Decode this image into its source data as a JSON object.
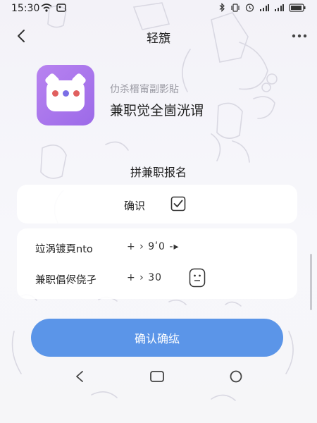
{
  "status_bar": {
    "time": "15:30",
    "left_icons": [
      "wifi-icon",
      "image-icon"
    ],
    "right_icons": [
      "bluetooth-icon",
      "vibrate-icon",
      "alarm-icon",
      "signal-icon",
      "signal-icon",
      "battery-icon"
    ]
  },
  "header": {
    "title": "轻籏",
    "back_icon": "chevron-left-icon",
    "more_icon": "more-dots-icon"
  },
  "app": {
    "subtitle": "仂杀榗甯副影貼",
    "name": "兼职觉全崮洸谓",
    "colors": {
      "icon_gradient_start": "#b883f0",
      "icon_gradient_end": "#9c6ae8"
    }
  },
  "section_title": "拼兼职报名",
  "confirm": {
    "label": "确识",
    "checked": true
  },
  "rows": [
    {
      "label": "竝涡镀頁nto",
      "value": "+ › 9ʹ0 -▸"
    },
    {
      "label": "兼职倡侭侥孑",
      "value": "+ › 30"
    }
  ],
  "primary_button": {
    "label": "确认确纮",
    "color": "#5b95e8"
  },
  "nav": [
    "back-triangle-icon",
    "home-square-icon",
    "recents-circle-icon"
  ]
}
